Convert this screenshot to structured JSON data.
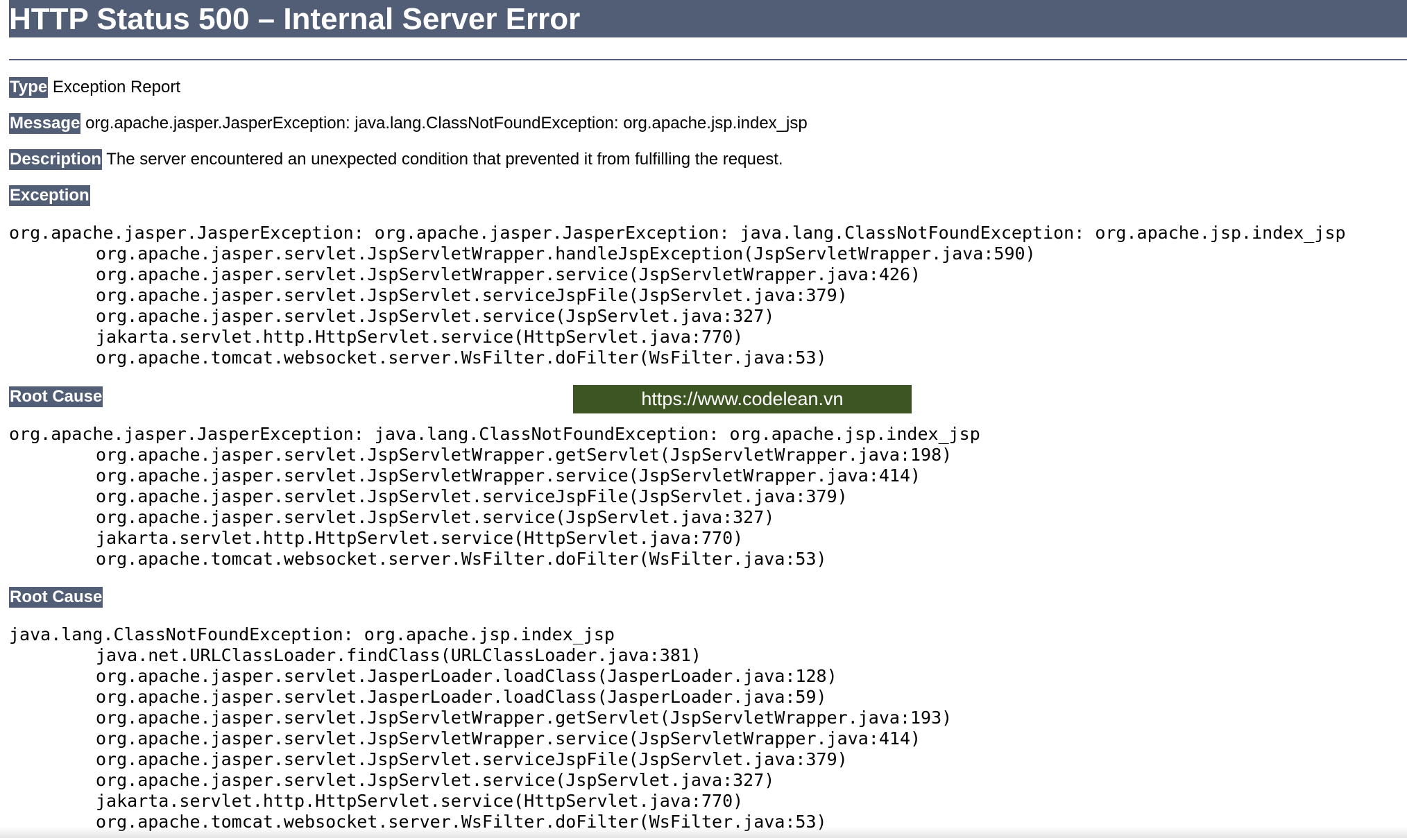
{
  "header": {
    "title": "HTTP Status 500 – Internal Server Error"
  },
  "type": {
    "label": "Type",
    "value": "Exception Report"
  },
  "message": {
    "label": "Message",
    "value": "org.apache.jasper.JasperException: java.lang.ClassNotFoundException: org.apache.jsp.index_jsp"
  },
  "description": {
    "label": "Description",
    "value": "The server encountered an unexpected condition that prevented it from fulfilling the request."
  },
  "exception": {
    "label": "Exception",
    "head": "org.apache.jasper.JasperException: org.apache.jasper.JasperException: java.lang.ClassNotFoundException: org.apache.jsp.index_jsp",
    "frames": [
      "org.apache.jasper.servlet.JspServletWrapper.handleJspException(JspServletWrapper.java:590)",
      "org.apache.jasper.servlet.JspServletWrapper.service(JspServletWrapper.java:426)",
      "org.apache.jasper.servlet.JspServlet.serviceJspFile(JspServlet.java:379)",
      "org.apache.jasper.servlet.JspServlet.service(JspServlet.java:327)",
      "jakarta.servlet.http.HttpServlet.service(HttpServlet.java:770)",
      "org.apache.tomcat.websocket.server.WsFilter.doFilter(WsFilter.java:53)"
    ]
  },
  "root_cause_1": {
    "label": "Root Cause",
    "head": "org.apache.jasper.JasperException: java.lang.ClassNotFoundException: org.apache.jsp.index_jsp",
    "frames": [
      "org.apache.jasper.servlet.JspServletWrapper.getServlet(JspServletWrapper.java:198)",
      "org.apache.jasper.servlet.JspServletWrapper.service(JspServletWrapper.java:414)",
      "org.apache.jasper.servlet.JspServlet.serviceJspFile(JspServlet.java:379)",
      "org.apache.jasper.servlet.JspServlet.service(JspServlet.java:327)",
      "jakarta.servlet.http.HttpServlet.service(HttpServlet.java:770)",
      "org.apache.tomcat.websocket.server.WsFilter.doFilter(WsFilter.java:53)"
    ]
  },
  "root_cause_2": {
    "label": "Root Cause",
    "head": "java.lang.ClassNotFoundException: org.apache.jsp.index_jsp",
    "frames": [
      "java.net.URLClassLoader.findClass(URLClassLoader.java:381)",
      "org.apache.jasper.servlet.JasperLoader.loadClass(JasperLoader.java:128)",
      "org.apache.jasper.servlet.JasperLoader.loadClass(JasperLoader.java:59)",
      "org.apache.jasper.servlet.JspServletWrapper.getServlet(JspServletWrapper.java:193)",
      "org.apache.jasper.servlet.JspServletWrapper.service(JspServletWrapper.java:414)",
      "org.apache.jasper.servlet.JspServlet.serviceJspFile(JspServlet.java:379)",
      "org.apache.jasper.servlet.JspServlet.service(JspServlet.java:327)",
      "jakarta.servlet.http.HttpServlet.service(HttpServlet.java:770)",
      "org.apache.tomcat.websocket.server.WsFilter.doFilter(WsFilter.java:53)"
    ]
  },
  "watermark": {
    "text": "https://www.codelean.vn"
  },
  "colors": {
    "header_bg": "#525d76",
    "watermark_bg": "#3d5423"
  }
}
